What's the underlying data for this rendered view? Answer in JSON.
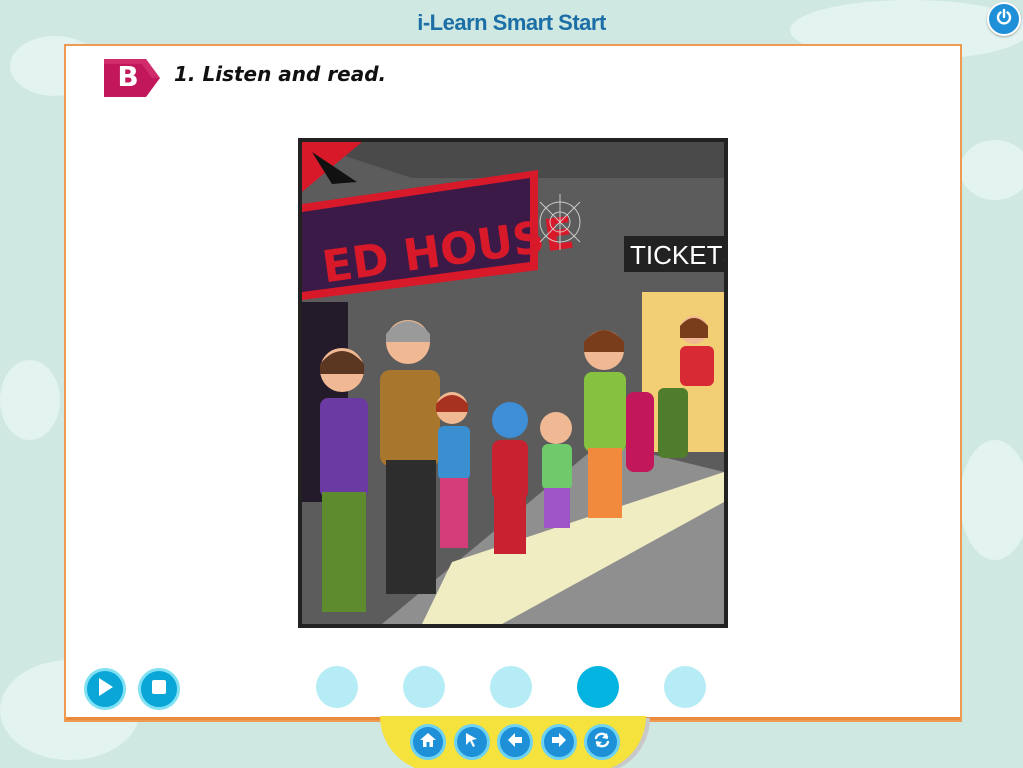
{
  "app": {
    "title": "i-Learn Smart Start"
  },
  "section": {
    "letter": "B",
    "instruction": "1. Listen and read."
  },
  "scene": {
    "sign_text": "ED HOUSE",
    "tickets_text": "TICKETS"
  },
  "controls": {
    "play_icon": "play-icon",
    "stop_icon": "stop-icon"
  },
  "page_dots": {
    "count": 5,
    "active_index": 3
  },
  "nav": {
    "items": [
      "home-icon",
      "cursor-icon",
      "arrow-left-icon",
      "arrow-right-icon",
      "refresh-icon"
    ]
  },
  "colors": {
    "title": "#1c6fa6",
    "panel_border": "#ee9a50",
    "badge": "#c2185b",
    "accent_blue": "#0aa6d8",
    "dot_inactive": "#b6ecf5",
    "dot_active": "#04b4e0",
    "nav_bar": "#f6e23c"
  }
}
